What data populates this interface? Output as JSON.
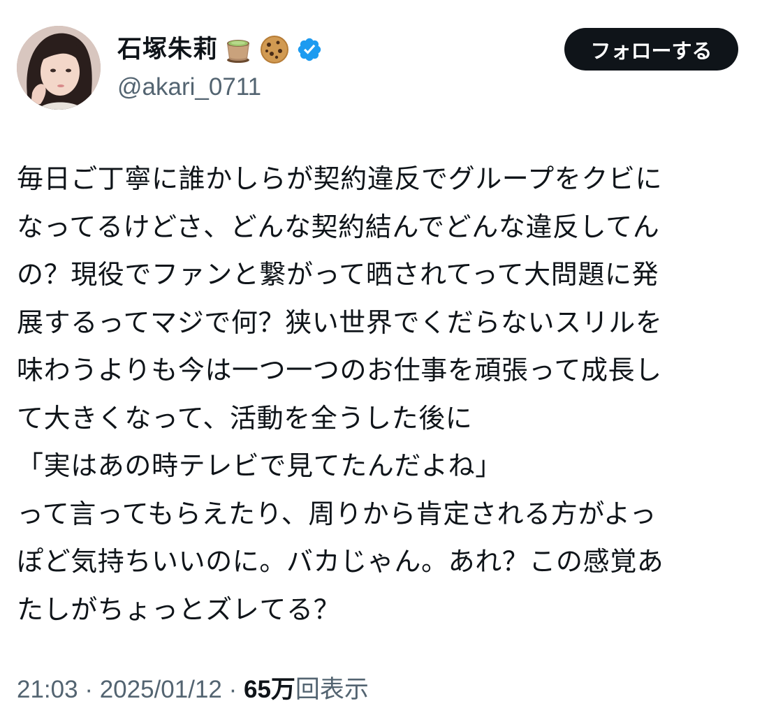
{
  "user": {
    "display_name": "石塚朱莉",
    "name_emojis": [
      "teacup-icon",
      "cookie-icon"
    ],
    "verified": true,
    "verified_color": "#1d9bf0",
    "handle": "@akari_0711"
  },
  "follow_button": {
    "label": "フォローする",
    "background": "#0f1419",
    "color": "#ffffff"
  },
  "tweet": {
    "lines": [
      "毎日ご丁寧に誰かしらが契約違反でグループをクビに",
      "なってるけどさ、どんな契約結んでどんな違反してん",
      "の？現役でファンと繋がって晒されてって大問題に発",
      "展するってマジで何？狭い世界でくだらないスリルを",
      "味わうよりも今は一つ一つのお仕事を頑張って成長し",
      "て大きくなって、活動を全うした後に",
      "「実はあの時テレビで見てたんだよね」",
      "って言ってもらえたり、周りから肯定される方がよっ",
      "ぽど気持ちいいのに。バカじゃん。あれ？この感覚あ",
      "たしがちょっとズレてる？"
    ]
  },
  "meta": {
    "time": "21:03",
    "separator": " · ",
    "date": "2025/01/12",
    "views_count": "65万",
    "views_label": "回表示"
  }
}
